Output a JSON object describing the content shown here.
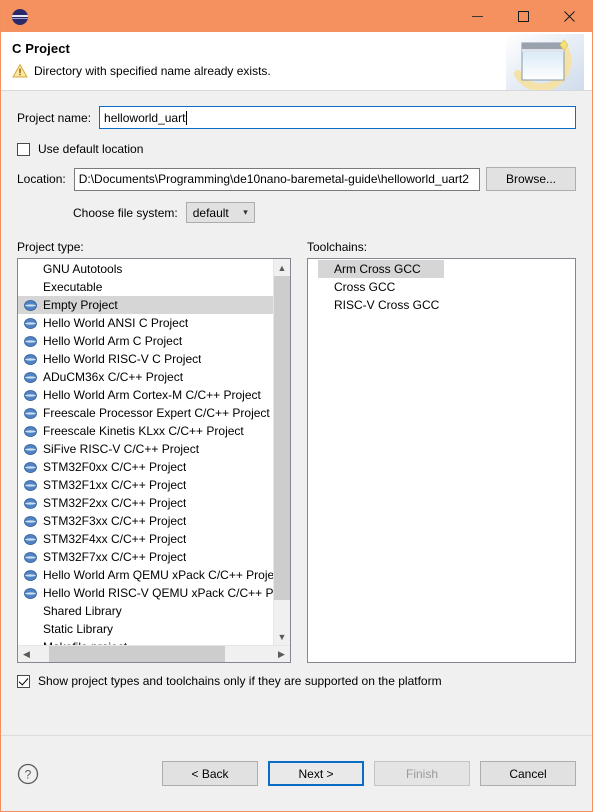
{
  "window": {
    "app_icon": "eclipse-icon",
    "minimize_label": "Minimize",
    "maximize_label": "Maximize",
    "close_label": "Close",
    "titlebar_color": "#f4915e",
    "border_color": "#f0905c"
  },
  "header": {
    "title": "C Project",
    "message": "Directory with specified name already exists.",
    "message_icon": "warning-icon",
    "banner_icon": "new-project-banner-icon"
  },
  "form": {
    "project_name_label": "Project name:",
    "project_name_value": "helloworld_uart",
    "use_default_location_label": "Use default location",
    "use_default_location_checked": false,
    "location_label": "Location:",
    "location_value": "D:\\Documents\\Programming\\de10nano-baremetal-guide\\helloworld_uart2",
    "browse_label": "Browse...",
    "file_system_label": "Choose file system:",
    "file_system_value": "default",
    "file_system_options": [
      "default"
    ]
  },
  "project_types": {
    "caption": "Project type:",
    "items": [
      {
        "label": "GNU Autotools",
        "icon": false,
        "selected": false
      },
      {
        "label": "Executable",
        "icon": false,
        "selected": false
      },
      {
        "label": "Empty Project",
        "icon": true,
        "selected": true
      },
      {
        "label": "Hello World ANSI C Project",
        "icon": true,
        "selected": false
      },
      {
        "label": "Hello World Arm C Project",
        "icon": true,
        "selected": false
      },
      {
        "label": "Hello World RISC-V C Project",
        "icon": true,
        "selected": false
      },
      {
        "label": "ADuCM36x C/C++ Project",
        "icon": true,
        "selected": false
      },
      {
        "label": "Hello World Arm Cortex-M C/C++ Project",
        "icon": true,
        "selected": false
      },
      {
        "label": "Freescale Processor Expert C/C++ Project",
        "icon": true,
        "selected": false
      },
      {
        "label": "Freescale Kinetis KLxx C/C++ Project",
        "icon": true,
        "selected": false
      },
      {
        "label": "SiFive RISC-V C/C++ Project",
        "icon": true,
        "selected": false
      },
      {
        "label": "STM32F0xx C/C++ Project",
        "icon": true,
        "selected": false
      },
      {
        "label": "STM32F1xx C/C++ Project",
        "icon": true,
        "selected": false
      },
      {
        "label": "STM32F2xx C/C++ Project",
        "icon": true,
        "selected": false
      },
      {
        "label": "STM32F3xx C/C++ Project",
        "icon": true,
        "selected": false
      },
      {
        "label": "STM32F4xx C/C++ Project",
        "icon": true,
        "selected": false
      },
      {
        "label": "STM32F7xx C/C++ Project",
        "icon": true,
        "selected": false
      },
      {
        "label": "Hello World Arm QEMU xPack C/C++ Project",
        "icon": true,
        "selected": false
      },
      {
        "label": "Hello World RISC-V QEMU xPack C/C++ Proj",
        "icon": true,
        "selected": false
      },
      {
        "label": "Shared Library",
        "icon": false,
        "selected": false
      },
      {
        "label": "Static Library",
        "icon": false,
        "selected": false
      },
      {
        "label": "Makefile project",
        "icon": false,
        "selected": false
      }
    ]
  },
  "toolchains": {
    "caption": "Toolchains:",
    "items": [
      {
        "label": "Arm Cross GCC",
        "selected": true
      },
      {
        "label": "Cross GCC",
        "selected": false
      },
      {
        "label": "RISC-V Cross GCC",
        "selected": false
      }
    ]
  },
  "platform_filter": {
    "label": "Show project types and toolchains only if they are supported on the platform",
    "checked": true
  },
  "footer": {
    "help_icon": "help-icon",
    "back_label": "< Back",
    "next_label": "Next >",
    "finish_label": "Finish",
    "cancel_label": "Cancel",
    "next_is_default": true,
    "finish_disabled": true,
    "focus_color": "#0a6cc4"
  }
}
